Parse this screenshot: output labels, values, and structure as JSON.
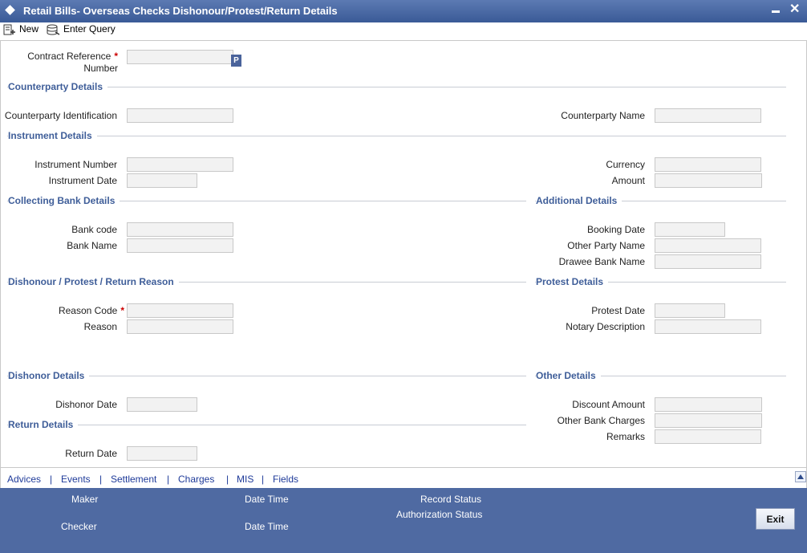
{
  "window": {
    "title": "Retail Bills- Overseas Checks Dishonour/Protest/Return Details",
    "minimize_glyph": "▬",
    "close_glyph": "✕"
  },
  "toolbar": {
    "new_label": "New",
    "enter_query_label": "Enter Query"
  },
  "contract": {
    "label_line1": "Contract Reference",
    "label_line2": "Number",
    "required_mark": "*",
    "value": "",
    "lookup_label": "P"
  },
  "counterparty": {
    "title": "Counterparty Details",
    "identification_label": "Counterparty Identification",
    "identification_value": "",
    "name_label": "Counterparty Name",
    "name_value": ""
  },
  "instrument": {
    "title": "Instrument Details",
    "number_label": "Instrument Number",
    "number_value": "",
    "date_label": "Instrument Date",
    "date_value": "",
    "currency_label": "Currency",
    "currency_value": "",
    "amount_label": "Amount",
    "amount_value": ""
  },
  "collecting_bank": {
    "title": "Collecting Bank Details",
    "code_label": "Bank code",
    "code_value": "",
    "name_label": "Bank Name",
    "name_value": ""
  },
  "additional": {
    "title": "Additional Details",
    "booking_date_label": "Booking Date",
    "booking_date_value": "",
    "other_party_label": "Other Party Name",
    "other_party_value": "",
    "drawee_bank_label": "Drawee Bank Name",
    "drawee_bank_value": ""
  },
  "reason": {
    "title": "Dishonour / Protest / Return Reason",
    "code_label": "Reason Code",
    "required_mark": "*",
    "code_value": "",
    "reason_label": "Reason",
    "reason_value": ""
  },
  "protest": {
    "title": "Protest Details",
    "date_label": "Protest Date",
    "date_value": "",
    "notary_label": "Notary Description",
    "notary_value": ""
  },
  "dishonor": {
    "title": "Dishonor Details",
    "date_label": "Dishonor Date",
    "date_value": ""
  },
  "return_details": {
    "title": "Return Details",
    "date_label": "Return Date",
    "date_value": ""
  },
  "other": {
    "title": "Other Details",
    "discount_label": "Discount Amount",
    "discount_value": "",
    "charges_label": "Other Bank Charges",
    "charges_value": "",
    "remarks_label": "Remarks",
    "remarks_value": ""
  },
  "tabs": [
    "Advices",
    "Events",
    "Settlement",
    "Charges",
    "MIS",
    "Fields"
  ],
  "tab_separator": "|",
  "footer": {
    "maker_label": "Maker",
    "checker_label": "Checker",
    "date_time_label": "Date Time",
    "record_status_label": "Record Status",
    "authorization_status_label": "Authorization Status",
    "exit_label": "Exit"
  },
  "colors": {
    "title_bar": "#3a5a97",
    "section_title": "#3f5e99",
    "footer": "#4f6aa2",
    "tab_link": "#1e3a99",
    "required": "#cc0000"
  }
}
